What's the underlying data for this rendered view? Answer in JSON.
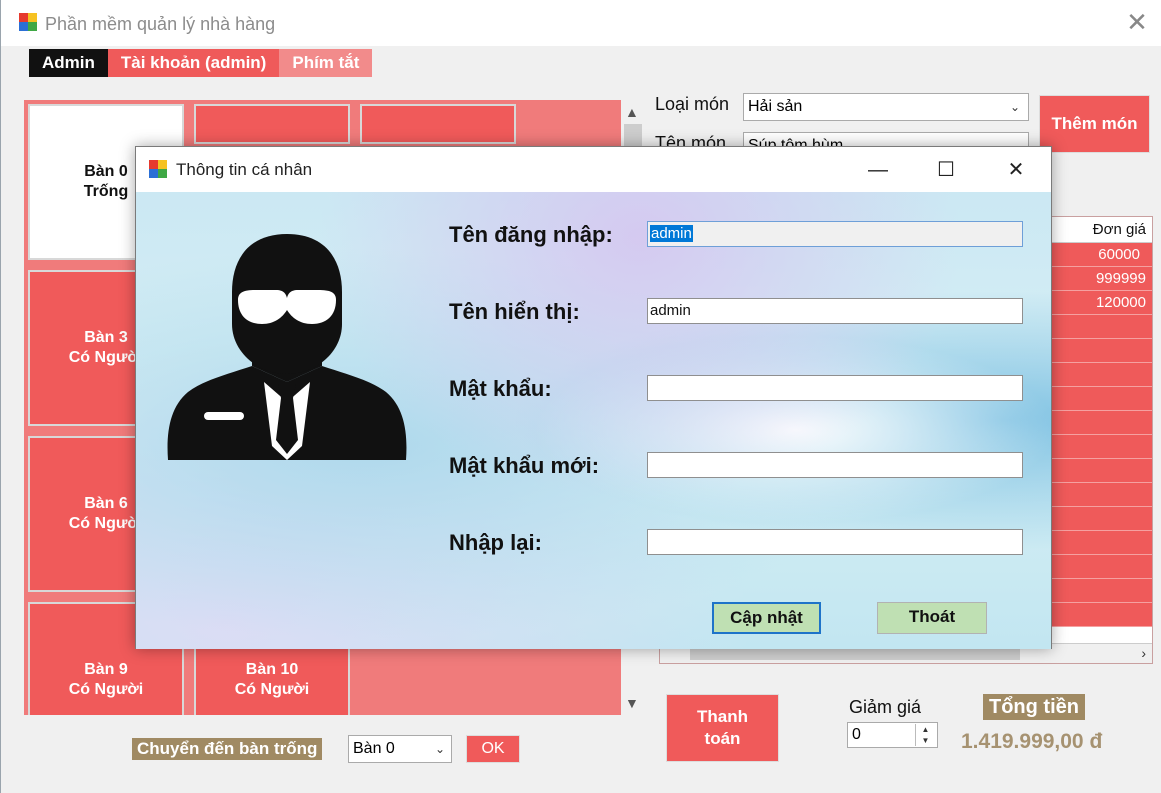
{
  "main_window": {
    "title": "Phần mềm quản lý nhà hàng",
    "close_glyph": "✕"
  },
  "menu": {
    "admin": "Admin",
    "account": "Tài khoản (admin)",
    "shortcut": "Phím tắt"
  },
  "tables": [
    {
      "name": "Bàn 0",
      "status": "Trống"
    },
    {
      "name": "Bàn 3",
      "status": "Có Người"
    },
    {
      "name": "Bàn 6",
      "status": "Có Người"
    },
    {
      "name": "Bàn 9",
      "status": "Có Người"
    },
    {
      "name": "Bàn 10",
      "status": "Có Người"
    }
  ],
  "move_table": {
    "label": "Chuyển đến bàn trống",
    "selected": "Bàn 0",
    "ok": "OK"
  },
  "food": {
    "category_label": "Loại món",
    "category_value": "Hải sản",
    "name_label": "Tên món",
    "name_value": "Súp tôm hùm",
    "add_button": "Thêm món"
  },
  "bill": {
    "col_price": "Đơn giá",
    "rows": [
      "60000",
      "999999",
      "120000"
    ]
  },
  "payment": {
    "pay_button_line1": "Thanh",
    "pay_button_line2": "toán",
    "discount_label": "Giảm giá",
    "discount_value": "0",
    "total_label": "Tổng tiền",
    "total_value": "1.419.999,00 đ"
  },
  "dialog": {
    "title": "Thông tin cá nhân",
    "minimize_glyph": "—",
    "maximize_glyph": "☐",
    "close_glyph": "✕",
    "labels": {
      "username": "Tên đăng nhập:",
      "display_name": "Tên hiển thị:",
      "password": "Mật khẩu:",
      "new_password": "Mật khẩu mới:",
      "retype": "Nhập lại:"
    },
    "values": {
      "username": "admin",
      "display_name": "admin",
      "password": "",
      "new_password": "",
      "retype": ""
    },
    "update_button": "Cập nhật",
    "exit_button": "Thoát"
  },
  "colors": {
    "accent_red": "#f05a5a",
    "light_red": "#f28b8b",
    "gold": "#a08a63",
    "button_green": "#bfe0b3"
  }
}
